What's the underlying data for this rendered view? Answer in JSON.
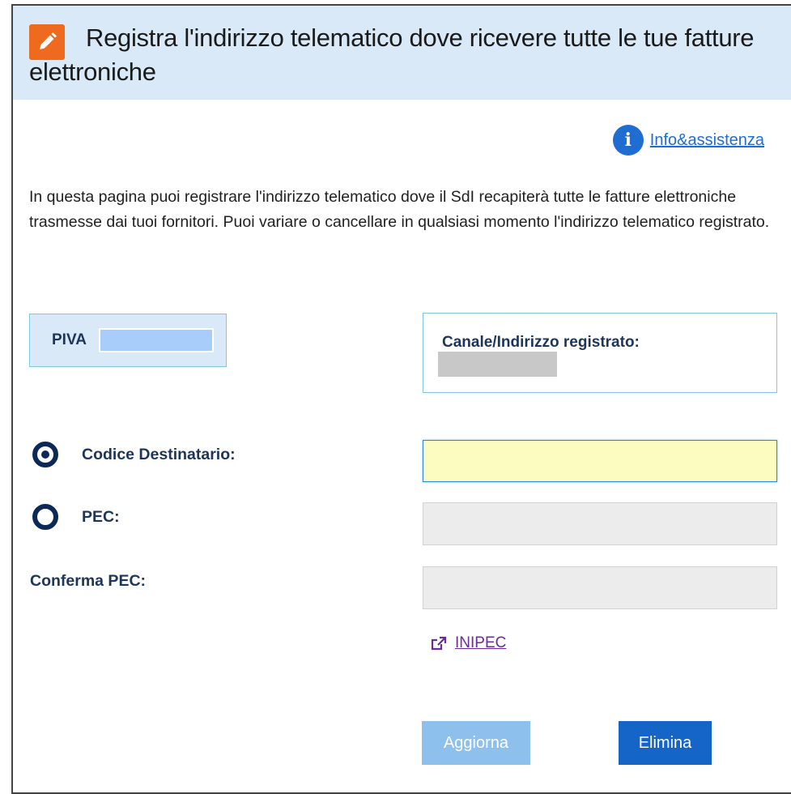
{
  "header": {
    "title": "Registra l'indirizzo telematico dove ricevere tutte le tue fatture elettroniche",
    "icon": "pencil-icon"
  },
  "help": {
    "icon": "info-icon",
    "link_label": "Info&assistenza"
  },
  "intro_text": "In questa pagina puoi registrare l'indirizzo telematico dove il SdI recapiterà tutte le fatture elettroniche trasmesse dai tuoi fornitori. Puoi variare o cancellare in qualsiasi momento l'indirizzo telematico registrato.",
  "piva": {
    "label": "PIVA"
  },
  "registered": {
    "label": "Canale/Indirizzo registrato:"
  },
  "form": {
    "codice_label": "Codice Destinatario:",
    "pec_label": "PEC:",
    "confirm_pec_label": "Conferma PEC:",
    "selected_option": "Codice Destinatario"
  },
  "inipec": {
    "icon": "external-link-icon",
    "label": "INIPEC"
  },
  "buttons": {
    "update_label": "Aggiorna",
    "delete_label": "Elimina"
  },
  "colors": {
    "header_bg": "#d9e9f8",
    "accent_orange": "#ee6a1e",
    "primary_blue": "#1565c8",
    "label_navy": "#1c3559"
  }
}
